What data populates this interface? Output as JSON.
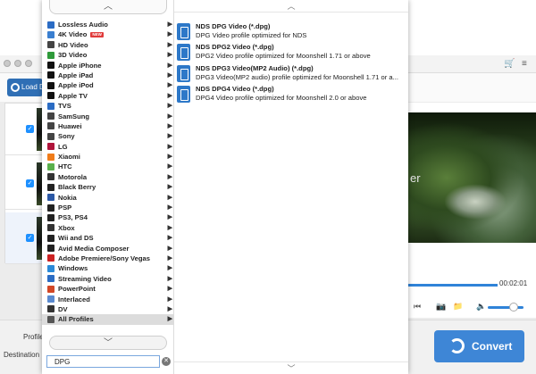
{
  "app": {
    "load_label": "Load D",
    "profile_label": "Profile",
    "destination_label": "Destination",
    "convert_label": "Convert",
    "time": "00:02:01",
    "preview_overlay_text": "er",
    "accent_color": "#3e86d6"
  },
  "categories": [
    {
      "label": "Lossless Audio",
      "icon": "music-note-icon",
      "color": "#2b6cc4"
    },
    {
      "label": "4K Video",
      "icon": "4k-icon",
      "color": "#3a7fd0",
      "badge": "NEW"
    },
    {
      "label": "HD Video",
      "icon": "hd-icon",
      "color": "#444444"
    },
    {
      "label": "3D Video",
      "icon": "3d-icon",
      "color": "#2f9a3a"
    },
    {
      "label": "Apple iPhone",
      "icon": "apple-icon",
      "color": "#111111"
    },
    {
      "label": "Apple iPad",
      "icon": "apple-icon",
      "color": "#111111"
    },
    {
      "label": "Apple iPod",
      "icon": "apple-icon",
      "color": "#111111"
    },
    {
      "label": "Apple TV",
      "icon": "apple-icon",
      "color": "#111111"
    },
    {
      "label": "TVS",
      "icon": "tv-icon",
      "color": "#2b6cc4"
    },
    {
      "label": "SamSung",
      "icon": "samsung-icon",
      "color": "#444444"
    },
    {
      "label": "Huawei",
      "icon": "huawei-icon",
      "color": "#444444"
    },
    {
      "label": "Sony",
      "icon": "sony-icon",
      "color": "#444444"
    },
    {
      "label": "LG",
      "icon": "lg-icon",
      "color": "#b0143b"
    },
    {
      "label": "Xiaomi",
      "icon": "xiaomi-icon",
      "color": "#f07c1a"
    },
    {
      "label": "HTC",
      "icon": "htc-icon",
      "color": "#5ab04c"
    },
    {
      "label": "Motorola",
      "icon": "motorola-icon",
      "color": "#333333"
    },
    {
      "label": "Black Berry",
      "icon": "blackberry-icon",
      "color": "#222222"
    },
    {
      "label": "Nokia",
      "icon": "nokia-icon",
      "color": "#2b58a6"
    },
    {
      "label": "PSP",
      "icon": "psp-icon",
      "color": "#222222"
    },
    {
      "label": "PS3, PS4",
      "icon": "playstation-icon",
      "color": "#222222"
    },
    {
      "label": "Xbox",
      "icon": "xbox-icon",
      "color": "#333333"
    },
    {
      "label": "Wii and DS",
      "icon": "wii-icon",
      "color": "#222222"
    },
    {
      "label": "Avid Media Composer",
      "icon": "avid-icon",
      "color": "#222222"
    },
    {
      "label": "Adobe Premiere/Sony Vegas",
      "icon": "adobe-icon",
      "color": "#cc2222"
    },
    {
      "label": "Windows",
      "icon": "windows-icon",
      "color": "#2b8ad8"
    },
    {
      "label": "Streaming Video",
      "icon": "streaming-icon",
      "color": "#2b6cc4"
    },
    {
      "label": "PowerPoint",
      "icon": "powerpoint-icon",
      "color": "#d24726"
    },
    {
      "label": "Interlaced",
      "icon": "interlaced-icon",
      "color": "#5a8ad0"
    },
    {
      "label": "DV",
      "icon": "dv-icon",
      "color": "#333333"
    },
    {
      "label": "All Profiles",
      "icon": "play-icon",
      "color": "#555555",
      "selected": true
    }
  ],
  "profiles": [
    {
      "name": "NDS DPG Video (*.dpg)",
      "desc": "DPG Video profile optimized for NDS"
    },
    {
      "name": "NDS DPG2 Video (*.dpg)",
      "desc": "DPG2 Video profile optimized for Moonshell 1.71 or above"
    },
    {
      "name": "NDS DPG3 Video(MP2 Audio) (*.dpg)",
      "desc": "DPG3 Video(MP2 audio) profile optimized for Moonshell 1.71 or a..."
    },
    {
      "name": "NDS DPG4 Video (*.dpg)",
      "desc": "DPG4 Video profile optimized for Moonshell 2.0 or above"
    }
  ],
  "search": {
    "value": "DPG"
  }
}
